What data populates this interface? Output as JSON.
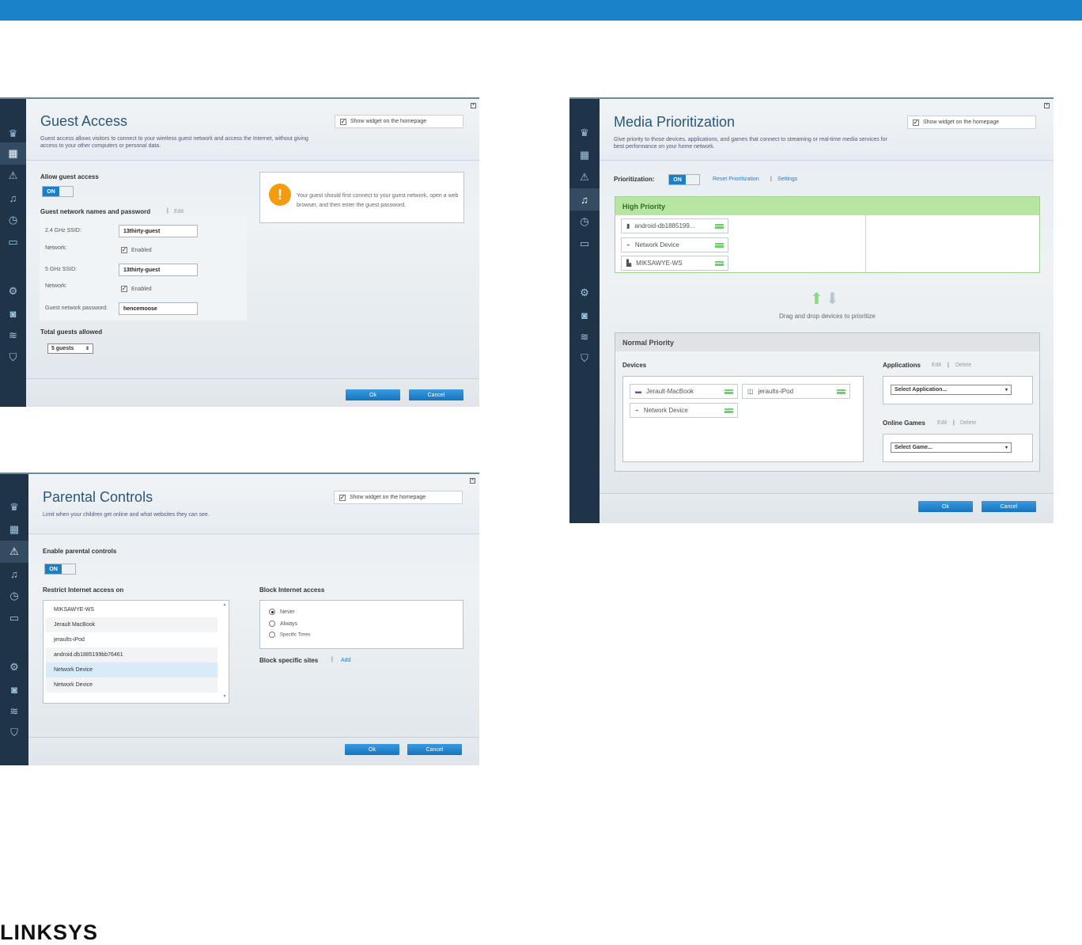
{
  "brand": "LINKSYS",
  "colors": {
    "accent": "#1a82c8",
    "high_priority": "#b7e6a3",
    "sidebar": "#1f3446"
  },
  "sidebar_icons": [
    "crown-icon",
    "calendar-icon",
    "warning-icon",
    "media-icon",
    "clock-icon",
    "device-icon",
    "gears-icon",
    "camera-icon",
    "wifi-icon",
    "shield-icon"
  ],
  "guest": {
    "title": "Guest Access",
    "desc": "Guest access allows visitors to connect to your wireless guest network and access the Internet, without giving access to your other computers or personal data.",
    "widget_label": "Show widget on the homepage",
    "allow_label": "Allow guest access",
    "toggle": "ON",
    "names_label": "Guest network names and password",
    "edit": "Edit",
    "ssid24_label": "2.4 GHz SSID:",
    "ssid24_value": "13thirty-guest",
    "network_label": "Network:",
    "enabled": "Enabled",
    "ssid5_label": "5 GHz SSID:",
    "ssid5_value": "13thirty-guest",
    "password_label": "Guest network password:",
    "password_value": "hencemoose",
    "total_label": "Total guests allowed",
    "guests_value": "5 guests",
    "notice": "Your guest should first connect to your guest network, open a web browser, and then enter the guest password.",
    "ok": "Ok",
    "cancel": "Cancel"
  },
  "parental": {
    "title": "Parental Controls",
    "desc": "Limit when your children get online and what websites they can see.",
    "widget_label": "Show widget on the homepage",
    "enable_label": "Enable parental controls",
    "toggle": "ON",
    "restrict_label": "Restrict Internet access on",
    "devices": [
      "MIKSAWYE-WS",
      "Jerault MacBook",
      "jeraults-iPod",
      "android.db1885199bb76461",
      "Network Device",
      "Network Device"
    ],
    "block_label": "Block Internet access",
    "options": [
      "Never",
      "Always",
      "Specific Times"
    ],
    "selected_option": "Never",
    "block_sites_label": "Block specific sites",
    "add": "Add",
    "ok": "Ok",
    "cancel": "Cancel"
  },
  "media": {
    "title": "Media Prioritization",
    "desc": "Give priority to those devices, applications, and games that connect to streaming or real-time media services for best performance on your home network.",
    "widget_label": "Show widget on the homepage",
    "prioritization_label": "Prioritization:",
    "toggle": "ON",
    "reset": "Reset Prioritization",
    "settings": "Settings",
    "high_priority": "High Priority",
    "high_devices": [
      "android-db1885199...",
      "Network Device",
      "MIKSAWYE-WS"
    ],
    "drag_hint": "Drag and drop devices to prioritize",
    "normal_priority": "Normal Priority",
    "devices_label": "Devices",
    "normal_devices": [
      "Jerault-MacBook",
      "jeraults-iPod",
      "Network Device"
    ],
    "applications_label": "Applications",
    "edit": "Edit",
    "delete": "Delete",
    "select_app": "Select Application...",
    "online_games_label": "Online Games",
    "select_game": "Select Game...",
    "ok": "Ok",
    "cancel": "Cancel"
  }
}
